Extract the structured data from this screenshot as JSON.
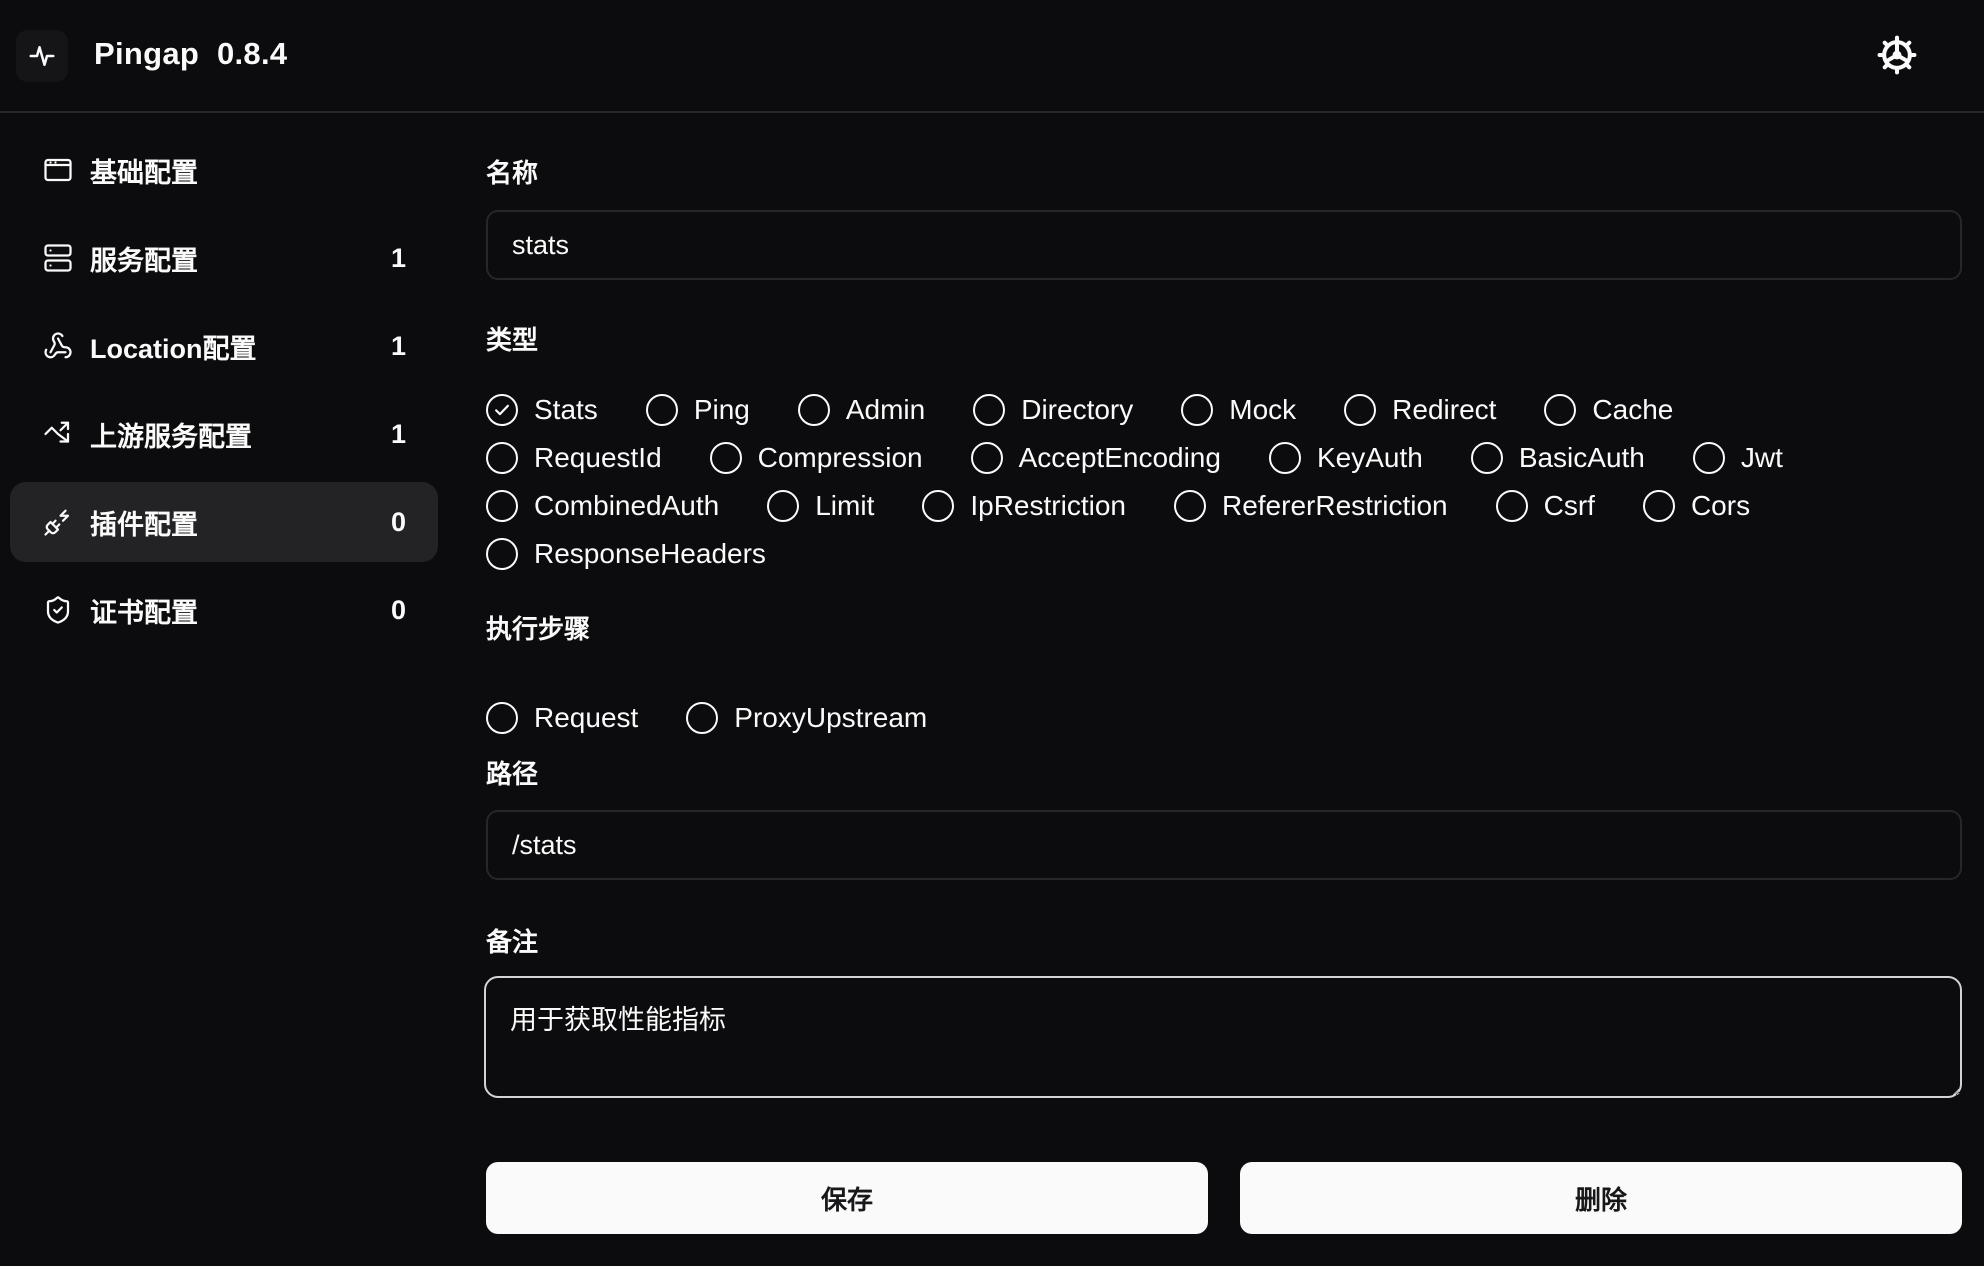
{
  "header": {
    "app_name": "Pingap",
    "version": "0.8.4",
    "logo_icon": "activity-pulse-icon",
    "settings_icon": "gear-icon"
  },
  "sidebar": {
    "items": [
      {
        "label": "基础配置",
        "count": "",
        "icon": "app-window-icon",
        "active": false
      },
      {
        "label": "服务配置",
        "count": "1",
        "icon": "server-icon",
        "active": false
      },
      {
        "label": "Location配置",
        "count": "1",
        "icon": "webhook-icon",
        "active": false
      },
      {
        "label": "上游服务配置",
        "count": "1",
        "icon": "trending-arrows-icon",
        "active": false
      },
      {
        "label": "插件配置",
        "count": "0",
        "icon": "plug-zap-icon",
        "active": true
      },
      {
        "label": "证书配置",
        "count": "0",
        "icon": "shield-check-icon",
        "active": false
      }
    ]
  },
  "form": {
    "name": {
      "label": "名称",
      "value": "stats"
    },
    "type": {
      "label": "类型",
      "selected": "Stats",
      "rows": [
        [
          "Stats",
          "Ping",
          "Admin",
          "Directory",
          "Mock",
          "Redirect",
          "Cache"
        ],
        [
          "RequestId",
          "Compression",
          "AcceptEncoding",
          "KeyAuth",
          "BasicAuth",
          "Jwt"
        ],
        [
          "CombinedAuth",
          "Limit",
          "IpRestriction",
          "RefererRestriction",
          "Csrf",
          "Cors"
        ],
        [
          "ResponseHeaders"
        ]
      ]
    },
    "step": {
      "label": "执行步骤",
      "selected": "",
      "options": [
        "Request",
        "ProxyUpstream"
      ]
    },
    "path": {
      "label": "路径",
      "value": "/stats"
    },
    "remark": {
      "label": "备注",
      "value": "用于获取性能指标"
    },
    "save_label": "保存",
    "delete_label": "删除"
  },
  "colors": {
    "background": "#0c0c0e",
    "active_nav": "#232326",
    "border": "#27272a",
    "focus_border": "#d4d4d8",
    "button_bg": "#fafafa",
    "button_text": "#18181b"
  }
}
